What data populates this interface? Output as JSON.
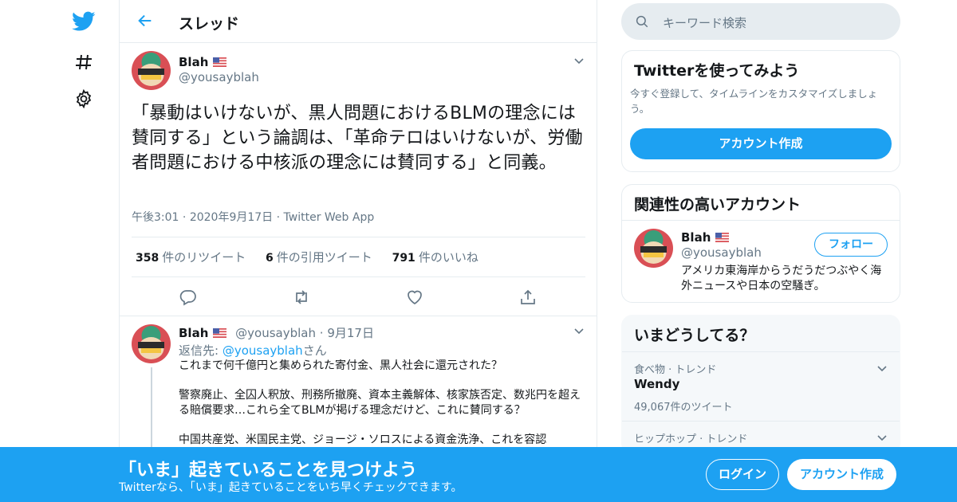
{
  "header": {
    "title": "スレッド"
  },
  "tweet": {
    "name": "Blah",
    "handle": "@yousayblah",
    "text": "「暴動はいけないが、黒人問題におけるBLMの理念には賛同する」という論調は、「革命テロはいけないが、労働者問題における中核派の理念には賛同する」と同義。",
    "time": "午後3:01",
    "date": "2020年9月17日",
    "source": "Twitter Web App",
    "retweets": "358",
    "retweets_label": "件のリツイート",
    "quotes": "6",
    "quotes_label": "件の引用ツイート",
    "likes": "791",
    "likes_label": "件のいいね"
  },
  "reply": {
    "name": "Blah",
    "handle": "@yousayblah",
    "date": "9月17日",
    "reply_to_prefix": "返信先:",
    "reply_to_handle": "@yousayblah",
    "reply_to_suffix": "さん",
    "para1": "これまで何千億円と集められた寄付金、黒人社会に還元された？",
    "para2": "警察廃止、全囚人釈放、刑務所撤廃、資本主義解体、核家族否定、数兆円を超える賠償要求…これら全てBLMが掲げる理念だけど、これに賛同する？",
    "para3": "中国共産党、米国民主党、ジョージ・ソロスによる資金洗浄、これを容認"
  },
  "sidebar": {
    "search_placeholder": "キーワード検索",
    "signup_card": {
      "title": "Twitterを使ってみよう",
      "desc": "今すぐ登録して、タイムラインをカスタマイズしましょう。",
      "button": "アカウント作成"
    },
    "related_card": {
      "title": "関連性の高いアカウント",
      "name": "Blah",
      "handle": "@yousayblah",
      "follow": "フォロー",
      "bio": "アメリカ東海岸からうだうだつぶやく海外ニュースや日本の空騒ぎ。"
    },
    "trends_card": {
      "title": "いまどうしてる？",
      "items": [
        {
          "context": "食べ物 · トレンド",
          "name": "Wendy",
          "count": "49,067件のツイート"
        },
        {
          "context": "ヒップホップ · トレンド",
          "name": "",
          "count": ""
        }
      ]
    }
  },
  "bottom_bar": {
    "title": "「いま」起きていることを見つけよう",
    "subtitle": "Twitterなら、「いま」起きていることをいち早くチェックできます。",
    "login": "ログイン",
    "signup": "アカウント作成"
  },
  "colors": {
    "accent": "#1da1f2",
    "border": "#e6ecf0",
    "secondary_text": "#657786"
  },
  "icons": [
    "twitter-bird-icon",
    "hashtag-icon",
    "gear-icon",
    "back-arrow-icon",
    "search-icon",
    "chevron-down-icon",
    "reply-icon",
    "retweet-icon",
    "like-icon",
    "share-icon",
    "us-flag-icon"
  ]
}
